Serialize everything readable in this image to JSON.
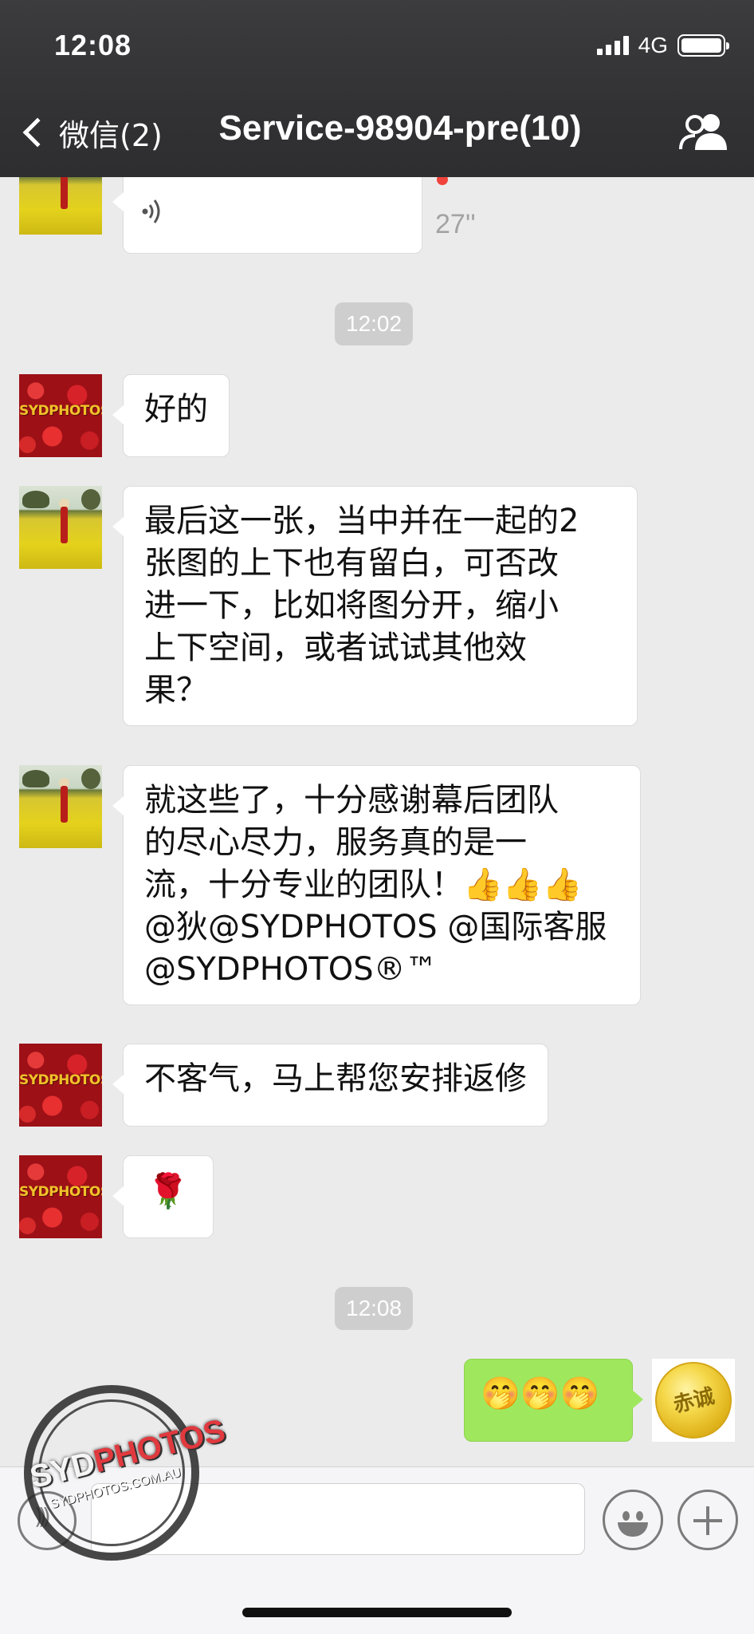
{
  "status_bar": {
    "time": "12:08",
    "network": "4G"
  },
  "nav": {
    "back_label": "微信(2)",
    "title": "Service-98904-pre(10)"
  },
  "messages": {
    "voice": {
      "duration": "27''"
    },
    "ts1": "12:02",
    "m1": "好的",
    "m2": [
      "最后这一张，当中并在一起的2",
      "张图的上下也有留白，可否改",
      "进一下，比如将图分开，缩小",
      "上下空间，或者试试其他效",
      "果？"
    ],
    "m3": [
      "就这些了，十分感谢幕后团队",
      "的尽心尽力，服务真的是一",
      "流，十分专业的团队！👍👍👍",
      "@狄@SYDPHOTOS @国际客服",
      "@SYDPHOTOS®™"
    ],
    "m4": "不客气，马上帮您安排返修",
    "m5": "🌹",
    "ts2": "12:08",
    "m6": "🤭🤭🤭"
  },
  "avatars": {
    "shop_logo_text": "SYDPHOTOS",
    "gold_coin_text": "赤诚"
  },
  "watermark": {
    "brand": "SYDPHOTOS",
    "brand_accent": "PHOTOS",
    "brand_lead": "SYD",
    "domain": "SYDPHOTOS.COM.AU"
  }
}
